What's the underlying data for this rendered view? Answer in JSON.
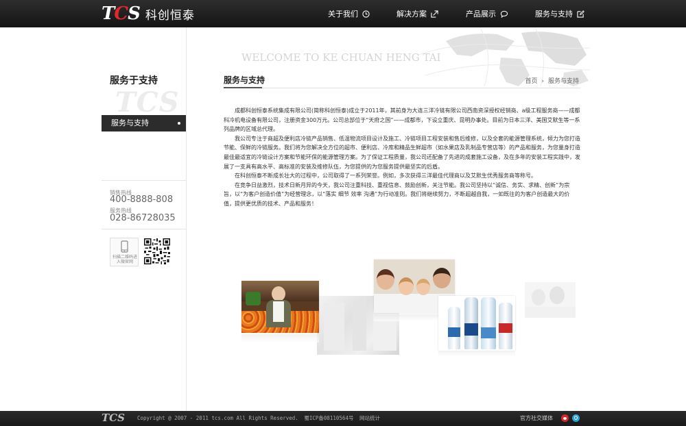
{
  "brand": {
    "logo_letters": "TCS",
    "name": "科创恒泰"
  },
  "nav": [
    {
      "label": "关于我们",
      "icon": "clock-icon"
    },
    {
      "label": "解决方案",
      "icon": "share-icon"
    },
    {
      "label": "产品展示",
      "icon": "chat-icon"
    },
    {
      "label": "服务与支持",
      "icon": "edit-icon"
    }
  ],
  "sidebar": {
    "title": "服务于支持",
    "watermark": "TCS",
    "active_item": "服务与支持",
    "hotline_label_1": "销售热线",
    "hotline_1": "400-8888-808",
    "hotline_label_2": "服务热线",
    "hotline_2": "028-86728035",
    "qr_caption": "扫描二维码进入微官网"
  },
  "banner": {
    "welcome": "WELCOME TO KE CHUAN HENG TAI"
  },
  "page": {
    "title": "服务与支持",
    "breadcrumb_home": "首页",
    "breadcrumb_sep": "›",
    "breadcrumb_current": "服务与支持"
  },
  "content": {
    "paragraphs": [
      "成都科创恒泰系统集成有限公司(简称科创恒泰)成立于2011年，其前身为大连三洋冷链有限公司西南资深授权经销商、a级工程服务商——成都科冷机电设备有限公司，注册资金300万元。公司总部位于“天府之国”——成都市，下设立重庆、昆明办事处。目前为日本三洋、美国艾默生等一系列品牌的区域总代理。",
      "我公司专注于商超及便利店冷链产品销售、低温物流项目设计及施工、冷链项目工程安装和售后维修，以及全套的能源管理系统，倾力为您打造节能、保鲜的冷链服务。我们将为您解决全方位的超市、便利店、冷库和精品生鲜超市（如水果店及乳制品专营店等）的产品和服务，为您量身打造最佳最适宜的冷链设计方案和节能环保的能源管理方案。为了保证工程质量，我公司还配备了先进的成套施工设备，及在多年的安装工程实践中，发展了一支具有高水平、高标准的安装及维修队伍，为您提供的为您服务提供最坚实的后盾。",
      "在科创恒泰不断成长壮大的过程中，公司取得了一系列荣誉。例如，多次获得三洋最佳代理商以及艾默生优秀服务商等称号。",
      "在竞争日益激烈，技术日新月异的今天，我公司注重科技、重视信息、鼓励创新，关注节能。我公司坚持以“诚信、务实、求精、创新”为宗旨，以“为客户创造价值”为经营理念，以“落实 细节 效率 沟通”为行动准则。我们将继续努力，不断超越自我，一如既往的为客户创造最大的价值，提供更优质的技术、产品和服务！"
    ]
  },
  "footer": {
    "logo": "TCS",
    "copyright": "Copyright @ 2007 - 2011 tcs.com All Rights Reserved.",
    "icp": "蜀ICP备08110564号",
    "stats": "网站统计",
    "social_label": "官方社交媒体"
  },
  "colors": {
    "header_bg": "#1c1c1c",
    "accent_red": "#e0282e",
    "weibo_red": "#d7262c",
    "tencent_blue": "#2aa4d8"
  }
}
